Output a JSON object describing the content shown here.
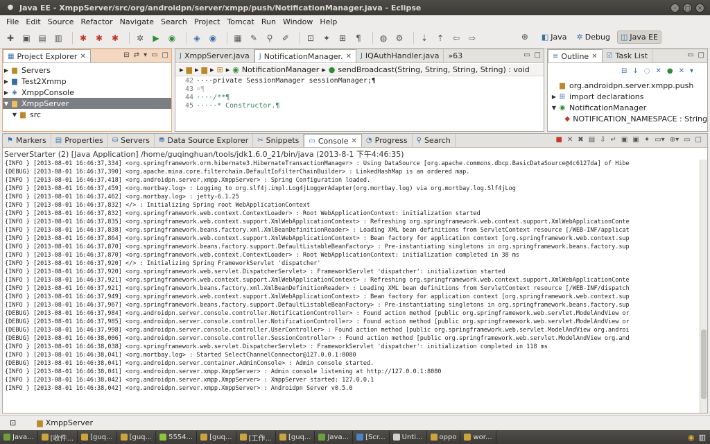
{
  "window": {
    "title": "Java EE - XmppServer/src/org/androidpn/server/xmpp/push/NotificationManager.java - Eclipse"
  },
  "menu": [
    "File",
    "Edit",
    "Source",
    "Refactor",
    "Navigate",
    "Search",
    "Project",
    "Tomcat",
    "Run",
    "Window",
    "Help"
  ],
  "perspectives": [
    "Java",
    "Debug",
    "Java EE"
  ],
  "explorer": {
    "tab": "Project Explorer",
    "items": [
      {
        "label": "Servers",
        "indent": 0,
        "selected": false
      },
      {
        "label": "Test2Xmmp",
        "indent": 0,
        "selected": false
      },
      {
        "label": "XmppConsole",
        "indent": 0,
        "selected": false
      },
      {
        "label": "XmppServer",
        "indent": 0,
        "selected": true
      },
      {
        "label": "src",
        "indent": 1,
        "selected": false
      }
    ]
  },
  "editor": {
    "tabs": [
      "XmppServer.java",
      "NotificationManager.",
      "IQAuthHandler.java",
      "»63"
    ],
    "breadcrumb_class": "NotificationManager",
    "breadcrumb_method": "sendBroadcast(String, String, String, String) : void",
    "lines": [
      {
        "num": "42",
        "text": "····private SessionManager sessionManager;¶"
      },
      {
        "num": "43",
        "text": "¤¶"
      },
      {
        "num": "44",
        "text": "····/**¶"
      },
      {
        "num": "45",
        "text": "·····* Constructor.¶"
      }
    ]
  },
  "outline": {
    "tabs": [
      "Outline",
      "Task List"
    ],
    "items": [
      "org.androidpn.server.xmpp.push",
      "import declarations",
      "NotificationManager",
      "NOTIFICATION_NAMESPACE : String"
    ]
  },
  "console_tabs": [
    "Markers",
    "Properties",
    "Servers",
    "Data Source Explorer",
    "Snippets",
    "Console",
    "Progress",
    "Search"
  ],
  "console": {
    "header": "ServerStarter (2) [Java Application] /home/guqinghuan/tools/jdk1.6.0_21/bin/java (2013-8-1 下午4:46:35)",
    "lines": [
      "{INFO } [2013-08-01 16:46:37,334] <org.springframework.orm.hibernate3.HibernateTransactionManager> : Using DataSource [org.apache.commons.dbcp.BasicDataSource@4c6127da] of Hibe",
      "{DEBUG} [2013-08-01 16:46:37,390] <org.apache.mina.core.filterchain.DefaultIoFilterChainBuilder> : LinkedHashMap is an ordered map.",
      "{INFO } [2013-08-01 16:46:37,418] <org.androidpn.server.xmpp.XmppServer> : Spring Configuration loaded.",
      "{INFO } [2013-08-01 16:46:37,459] <org.mortbay.log> : Logging to org.slf4j.impl.Log4jLoggerAdapter(org.mortbay.log) via org.mortbay.log.Slf4jLog",
      "{INFO } [2013-08-01 16:46:37,462] <org.mortbay.log> : jetty-6.1.25",
      "{INFO } [2013-08-01 16:46:37,832] </> : Initializing Spring root WebApplicationContext",
      "{INFO } [2013-08-01 16:46:37,832] <org.springframework.web.context.ContextLoader> : Root WebApplicationContext: initialization started",
      "{INFO } [2013-08-01 16:46:37,835] <org.springframework.web.context.support.XmlWebApplicationContext> : Refreshing org.springframework.web.context.support.XmlWebApplicationConte",
      "{INFO } [2013-08-01 16:46:37,838] <org.springframework.beans.factory.xml.XmlBeanDefinitionReader> : Loading XML bean definitions from ServletContext resource [/WEB-INF/applicat",
      "{INFO } [2013-08-01 16:46:37,864] <org.springframework.web.context.support.XmlWebApplicationContext> : Bean factory for application context [org.springframework.web.context.sup",
      "{INFO } [2013-08-01 16:46:37,870] <org.springframework.beans.factory.support.DefaultListableBeanFactory> : Pre-instantiating singletons in org.springframework.beans.factory.sup",
      "{INFO } [2013-08-01 16:46:37,870] <org.springframework.web.context.ContextLoader> : Root WebApplicationContext: initialization completed in 38 ms",
      "{INFO } [2013-08-01 16:46:37,920] </> : Initializing Spring FrameworkServlet 'dispatcher'",
      "{INFO } [2013-08-01 16:46:37,920] <org.springframework.web.servlet.DispatcherServlet> : FrameworkServlet 'dispatcher': initialization started",
      "{INFO } [2013-08-01 16:46:37,921] <org.springframework.web.context.support.XmlWebApplicationContext> : Refreshing org.springframework.web.context.support.XmlWebApplicationConte",
      "{INFO } [2013-08-01 16:46:37,921] <org.springframework.beans.factory.xml.XmlBeanDefinitionReader> : Loading XML bean definitions from ServletContext resource [/WEB-INF/dispatch",
      "{INFO } [2013-08-01 16:46:37,949] <org.springframework.web.context.support.XmlWebApplicationContext> : Bean factory for application context [org.springframework.web.context.sup",
      "{INFO } [2013-08-01 16:46:37,967] <org.springframework.beans.factory.support.DefaultListableBeanFactory> : Pre-instantiating singletons in org.springframework.beans.factory.sup",
      "{DEBUG} [2013-08-01 16:46:37,984] <org.androidpn.server.console.controller.NotificationController> : Found action method [public org.springframework.web.servlet.ModelAndView or",
      "{DEBUG} [2013-08-01 16:46:37,985] <org.androidpn.server.console.controller.NotificationController> : Found action method [public org.springframework.web.servlet.ModelAndView or",
      "{DEBUG} [2013-08-01 16:46:37,998] <org.androidpn.server.console.controller.UserController> : Found action method [public org.springframework.web.servlet.ModelAndView org.androi",
      "{DEBUG} [2013-08-01 16:46:38,006] <org.androidpn.server.console.controller.SessionController> : Found action method [public org.springframework.web.servlet.ModelAndView org.and",
      "{INFO } [2013-08-01 16:46:38,038] <org.springframework.web.servlet.DispatcherServlet> : FrameworkServlet 'dispatcher': initialization completed in 118 ms",
      "{INFO } [2013-08-01 16:46:38,041] <org.mortbay.log> : Started SelectChannelConnector@127.0.0.1:8080",
      "{DEBUG} [2013-08-01 16:46:38,041] <org.androidpn.server.container.AdminConsole> : Admin console started.",
      "{INFO } [2013-08-01 16:46:38,041] <org.androidpn.server.xmpp.XmppServer> : Admin console listening at http://127.0.0.1:8080",
      "{INFO } [2013-08-01 16:46:38,042] <org.androidpn.server.xmpp.XmppServer> : XmppServer started: 127.0.0.1",
      "{INFO } [2013-08-01 16:46:38,042] <org.androidpn.server.xmpp.XmppServer> : Androidpn Server v0.5.0"
    ]
  },
  "status": {
    "item": "XmppServer"
  },
  "taskbar": [
    {
      "label": "Java...",
      "color": "#6d9f3a"
    },
    {
      "label": "[收件...",
      "color": "#c9a53b"
    },
    {
      "label": "[guq...",
      "color": "#c9a53b"
    },
    {
      "label": "[guq...",
      "color": "#c9a53b"
    },
    {
      "label": "5554...",
      "color": "#8cc43a"
    },
    {
      "label": "[guq...",
      "color": "#c9a53b"
    },
    {
      "label": "[工作...",
      "color": "#c9a53b"
    },
    {
      "label": "[guq...",
      "color": "#c9a53b"
    },
    {
      "label": "Java...",
      "color": "#6d9f3a"
    },
    {
      "label": "[Scr...",
      "color": "#4a84c4"
    },
    {
      "label": "Unti...",
      "color": "#d0d0d0"
    },
    {
      "label": "oppo",
      "color": "#c9a53b"
    },
    {
      "label": "wor...",
      "color": "#c9a53b"
    }
  ],
  "colors": {
    "explorer_accent": "#e8a878",
    "titlebar": "#3b3a36",
    "selection": "#7b7e83"
  }
}
